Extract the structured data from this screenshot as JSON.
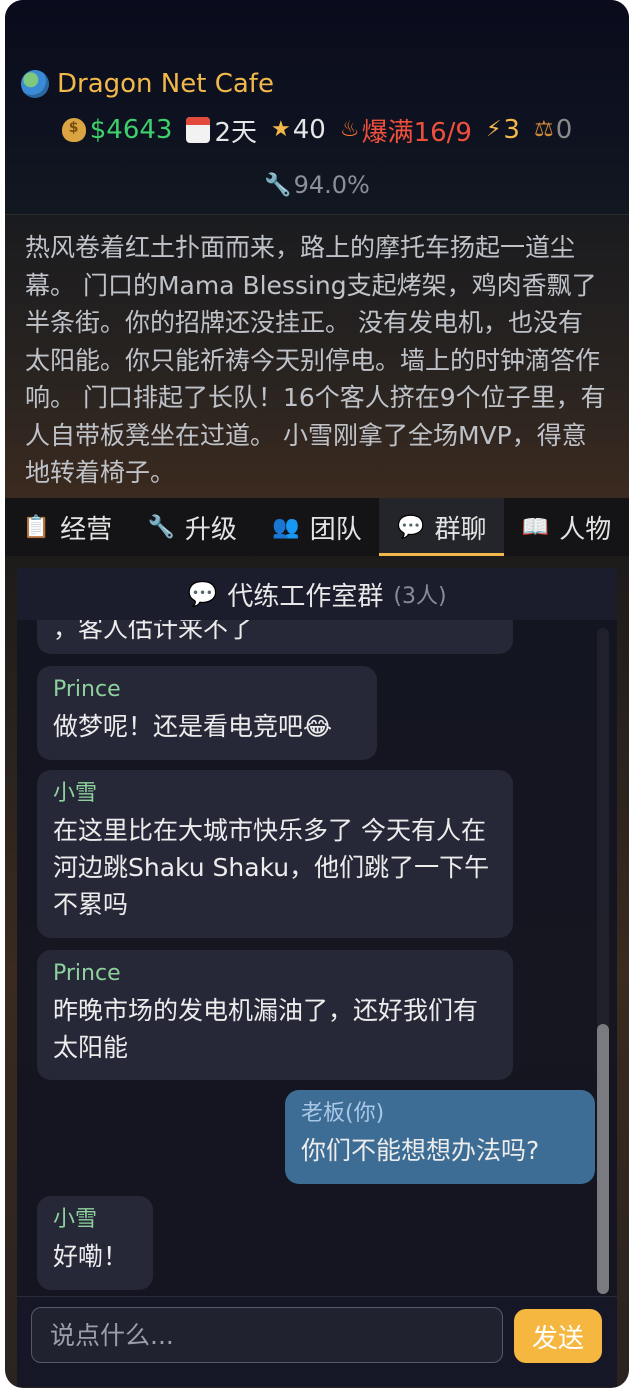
{
  "header": {
    "cafe_name": "Dragon Net Cafe",
    "money": "$4643",
    "days": "2天",
    "stars": "40",
    "full_status": "爆满16/9",
    "power": "3",
    "scale": "0",
    "health": "94.0%"
  },
  "story": {
    "text": "热风卷着红土扑面而来，路上的摩托车扬起一道尘幕。 门口的Mama Blessing支起烤架，鸡肉香飘了半条街。你的招牌还没挂正。 没有发电机，也没有太阳能。你只能祈祷今天别停电。墙上的时钟滴答作响。 门口排起了长队！16个客人挤在9个位子里，有人自带板凳坐在过道。 小雪刚拿了全场MVP，得意地转着椅子。"
  },
  "tabs": [
    {
      "label": "经营"
    },
    {
      "label": "升级"
    },
    {
      "label": "团队"
    },
    {
      "label": "群聊"
    },
    {
      "label": "人物"
    }
  ],
  "chat": {
    "title": "代练工作室群",
    "member_count": "(3人)",
    "partial_top": "，客人估计来不了",
    "messages": [
      {
        "sender": "Prince",
        "text": "做梦呢！还是看电竞吧😂"
      },
      {
        "sender": "小雪",
        "text": "在这里比在大城市快乐多了 今天有人在河边跳Shaku Shaku，他们跳了一下午不累吗"
      },
      {
        "sender": "Prince",
        "text": "昨晚市场的发电机漏油了，还好我们有太阳能"
      },
      {
        "sender": "老板(你)",
        "text": "你们不能想想办法吗?"
      },
      {
        "sender": "小雪",
        "text": "好嘞！"
      }
    ],
    "input_placeholder": "说点什么...",
    "send_label": "发送"
  },
  "colors": {
    "accent": "#f5b73f",
    "money": "#3fcf6b",
    "alert": "#f0503c",
    "sender": "#8fd19e",
    "own_bubble": "#3d6d94"
  }
}
